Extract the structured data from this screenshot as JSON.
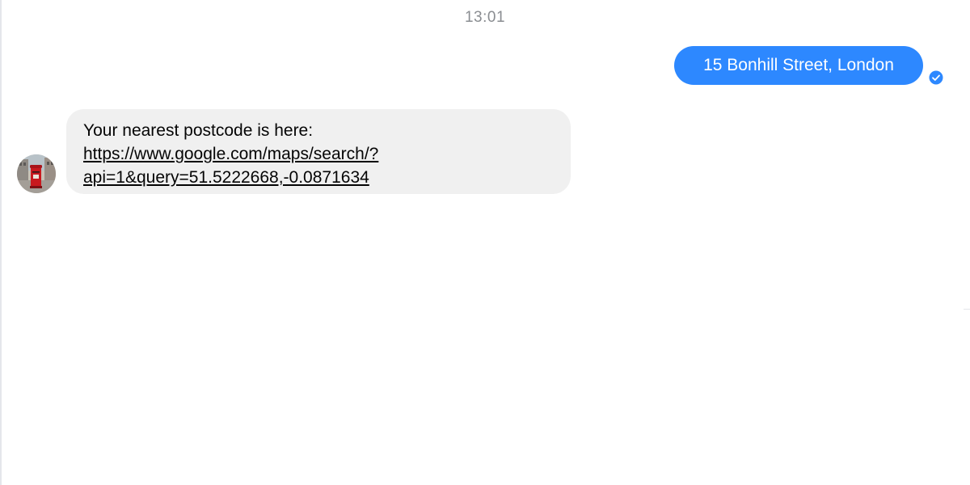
{
  "conversation": {
    "timestamp": "13:01",
    "outgoing_message": {
      "text": "15 Bonhill Street, London",
      "status_icon": "seen-check-icon",
      "bubble_color": "#2d88ff"
    },
    "incoming_message": {
      "intro": "Your nearest postcode is here:",
      "link_line_1": "https://www.google.com/maps/search/?",
      "link_line_2": "api=1&query=51.5222668,-0.0871634",
      "bubble_color": "#f0f0f0"
    },
    "sender_avatar": {
      "icon": "postbox-avatar-image"
    }
  }
}
